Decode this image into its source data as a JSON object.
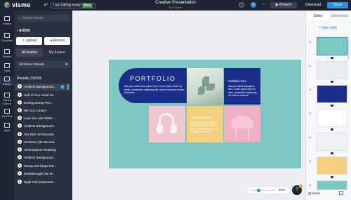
{
  "topbar": {
    "logo": "visme",
    "mode_label": "Live editing mode",
    "mode_badge": "Beta",
    "doc_title": "Creative Presentation",
    "doc_subtitle": "By Fiorella",
    "avatar_initial": "F",
    "more": "⋯",
    "present": "▶  Present",
    "download": "Download",
    "share": "Share"
  },
  "rail": [
    {
      "label": "Basics"
    },
    {
      "label": "Graphics"
    },
    {
      "label": "Photos"
    },
    {
      "label": "Data"
    },
    {
      "label": "Media"
    },
    {
      "label": "Theme Colors"
    },
    {
      "label": "My Files"
    },
    {
      "label": "Apps"
    }
  ],
  "panel": {
    "search_placeholder": "Search Audio",
    "back_label": "AUDIO",
    "upload": "Upload",
    "record": "Record",
    "tab_all": "All Audios",
    "tab_my": "My Audios",
    "genre": "All Genre / Moods",
    "results": "Results (10000)",
    "tracks": [
      "Ambient Background...",
      "Half of Your Heart 30...",
      "Driving Stomp Perc...",
      "We Got Contact",
      "Love You Like Water ...",
      "Ambient Background...",
      "Our Rise 30 Seconds",
      "Sunshine (30 Second...",
      "Athmosphere Relaxing",
      "Ambient Background...",
      "Stomp and Claps Ent...",
      "Breakthrough (No M...",
      "Night Call (Instrumen..."
    ]
  },
  "slide": {
    "title": "PORTFOLIO",
    "desc": "Add your detail description here. Lorem ipsum dolor sit amet, consectetur adipiscing elit, sed do eiusmod tempor incididunt.",
    "sub1_title": "Subtitle Here",
    "sub1_text": "Add your detail description here. Lorem ipsum dolor sit amet, consectetur adipiscing elit, sed do eiusmod.",
    "sub2_title": "Subtitle Here",
    "sub2_text": "Add your detail description here. Lorem ipsum dolor sit amet, consectetur adipiscing elit, sed do eiusmod."
  },
  "zoom": {
    "percent": "59%",
    "level": 0.59
  },
  "help": {
    "label": "?"
  },
  "right": {
    "tab_slides": "Slides",
    "tab_comments": "Comments",
    "new_slide": "+ New slide",
    "slides": [
      "10",
      "11",
      "12",
      "13",
      "14",
      "15",
      "16"
    ],
    "notes": "Notes"
  },
  "colors": {
    "dark": "#1d2533",
    "panel": "#29313f",
    "accent": "#2e8de0",
    "teal": "#7dc8c2",
    "navy": "#1b2e8a",
    "yellow": "#f3cf7e",
    "pink": "#f0b0c4"
  }
}
